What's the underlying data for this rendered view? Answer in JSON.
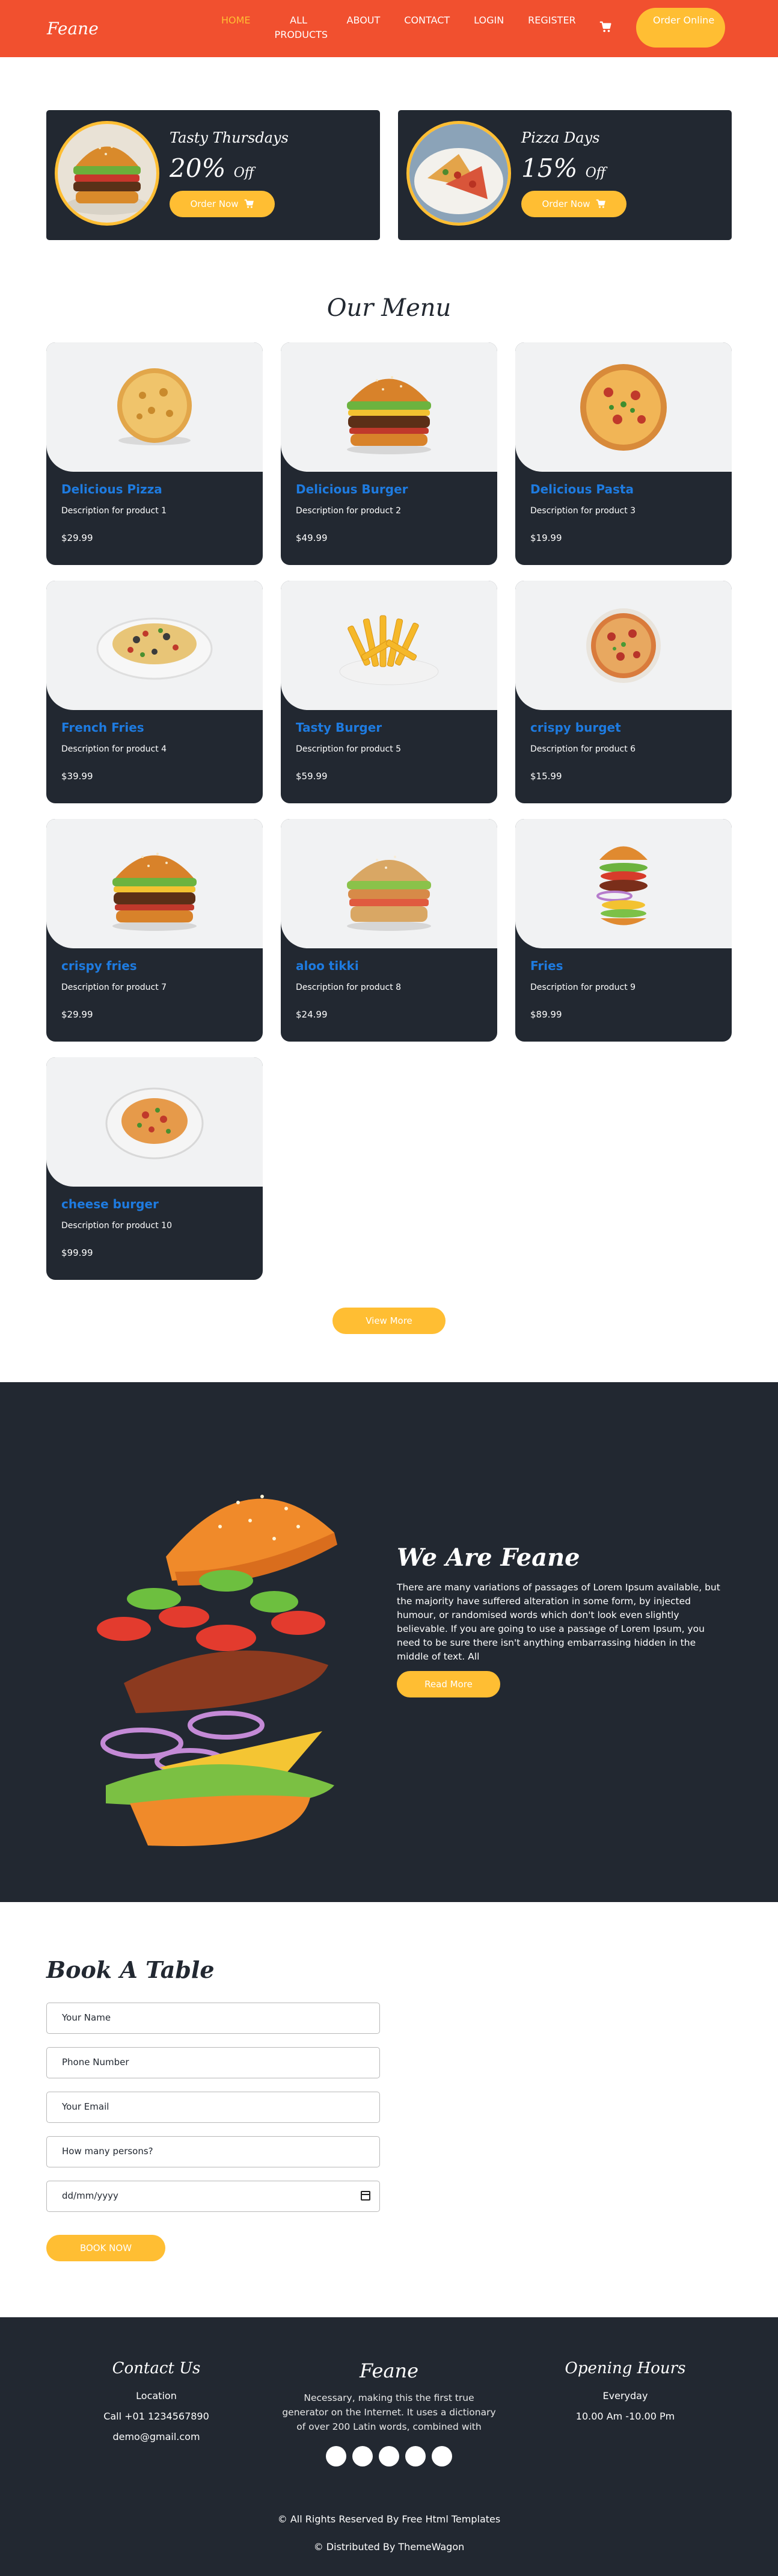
{
  "header": {
    "brand": "Feane",
    "nav": [
      {
        "label": "HOME",
        "active": true
      },
      {
        "label": "ALL PRODUCTS",
        "active": false
      },
      {
        "label": "ABOUT",
        "active": false
      },
      {
        "label": "CONTACT",
        "active": false
      },
      {
        "label": "LOGIN",
        "active": false
      },
      {
        "label": "REGISTER",
        "active": false
      }
    ],
    "cart_icon": "cart-icon",
    "order_online": "Order Online"
  },
  "offers": [
    {
      "title": "Tasty Thursdays",
      "percent": "20%",
      "suffix": "Off",
      "button": "Order Now"
    },
    {
      "title": "Pizza Days",
      "percent": "15%",
      "suffix": "Off",
      "button": "Order Now"
    }
  ],
  "menu": {
    "title": "Our Menu",
    "items": [
      {
        "name": "Delicious Pizza",
        "desc": "Description for product 1",
        "price": "$29.99",
        "food": "pizza"
      },
      {
        "name": "Delicious Burger",
        "desc": "Description for product 2",
        "price": "$49.99",
        "food": "burger"
      },
      {
        "name": "Delicious Pasta",
        "desc": "Description for product 3",
        "price": "$19.99",
        "food": "pizza-topped"
      },
      {
        "name": "French Fries",
        "desc": "Description for product 4",
        "price": "$39.99",
        "food": "pasta-plate"
      },
      {
        "name": "Tasty Burger",
        "desc": "Description for product 5",
        "price": "$59.99",
        "food": "fries"
      },
      {
        "name": "crispy burget",
        "desc": "Description for product 6",
        "price": "$15.99",
        "food": "pizza-small"
      },
      {
        "name": "crispy fries",
        "desc": "Description for product 7",
        "price": "$29.99",
        "food": "burger"
      },
      {
        "name": "aloo tikki",
        "desc": "Description for product 8",
        "price": "$24.99",
        "food": "burger-plain"
      },
      {
        "name": "Fries",
        "desc": "Description for product 9",
        "price": "$89.99",
        "food": "burger-stack"
      },
      {
        "name": "cheese burger",
        "desc": "Description for product 10",
        "price": "$99.99",
        "food": "pasta-bowl"
      }
    ],
    "view_more": "View More"
  },
  "about": {
    "title": "We Are Feane",
    "text": "There are many variations of passages of Lorem Ipsum available, but the majority have suffered alteration in some form, by injected humour, or randomised words which don't look even slightly believable. If you are going to use a passage of Lorem Ipsum, you need to be sure there isn't anything embarrassing hidden in the middle of text. All",
    "button": "Read More"
  },
  "book": {
    "title": "Book A Table",
    "fields": [
      {
        "placeholder": "Your Name"
      },
      {
        "placeholder": "Phone Number"
      },
      {
        "placeholder": "Your Email"
      },
      {
        "placeholder": "How many persons?"
      },
      {
        "placeholder": "dd/mm/yyyy"
      }
    ],
    "button": "BOOK NOW"
  },
  "footer": {
    "contact": {
      "title": "Contact Us",
      "location": "Location",
      "phone": "Call +01 1234567890",
      "email": "demo@gmail.com"
    },
    "brand": {
      "title": "Feane",
      "text": "Necessary, making this the first true generator on the Internet. It uses a dictionary of over 200 Latin words, combined with"
    },
    "hours": {
      "title": "Opening Hours",
      "days": "Everyday",
      "time": "10.00 Am -10.00 Pm"
    },
    "copyright": "© All Rights Reserved By Free Html Templates",
    "distributed": "© Distributed By ThemeWagon"
  },
  "colors": {
    "header": "#f1502f",
    "accent": "#ffbe33",
    "dark": "#222831",
    "link": "#1e7be0"
  }
}
